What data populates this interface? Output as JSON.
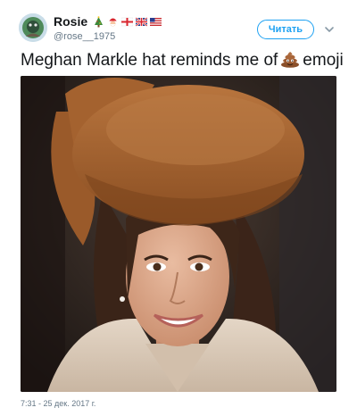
{
  "author": {
    "display_name": "Rosie",
    "handle": "@rose__1975",
    "name_emojis": [
      "christmas-tree-icon",
      "santa-icon",
      "england-flag-icon",
      "uk-flag-icon",
      "us-flag-icon"
    ]
  },
  "follow_button": {
    "label": "Читать"
  },
  "menu": {
    "icon": "chevron-down-icon"
  },
  "tweet": {
    "text_before": "Meghan Markle hat reminds me of",
    "emoji": "poop-icon",
    "text_after": "emoji"
  },
  "media": {
    "description_icon": "photo-image"
  },
  "timestamp": "7:31 - 25 дек. 2017 г.",
  "colors": {
    "accent": "#1da1f2",
    "text": "#14171a",
    "secondary_text": "#657786",
    "hat": "#a0602e"
  }
}
